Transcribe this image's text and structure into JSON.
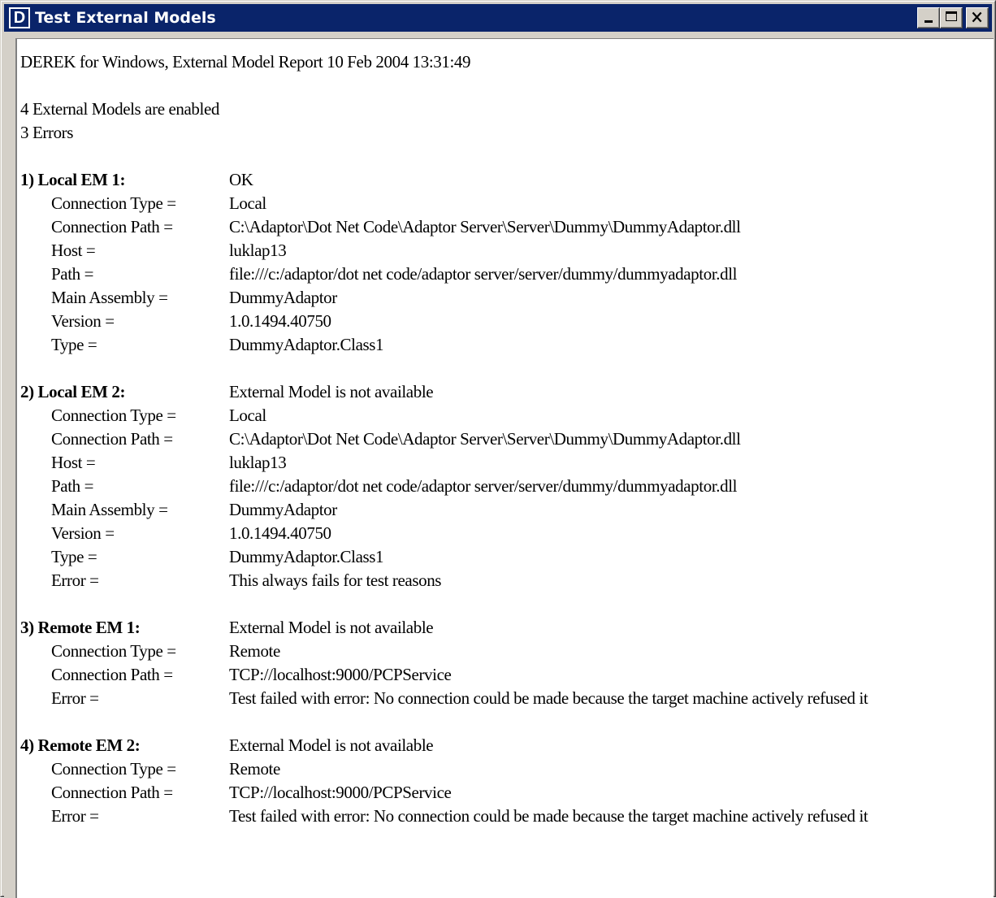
{
  "window": {
    "title": "Test External Models",
    "app_icon_letter": "D",
    "buttons": {
      "minimize": "minimize-button",
      "maximize": "maximize-button",
      "close": "close-button"
    }
  },
  "report": {
    "heading": "DEREK for Windows, External Model Report  10 Feb 2004  13:31:49",
    "enabled_line": "4 External Models are enabled",
    "errors_line": "3 Errors",
    "sections": [
      {
        "label": "1) Local EM 1:",
        "status": "OK",
        "rows": [
          {
            "key": "Connection Type =",
            "value": "Local"
          },
          {
            "key": "Connection Path =",
            "value": "C:\\Adaptor\\Dot Net Code\\Adaptor Server\\Server\\Dummy\\DummyAdaptor.dll"
          },
          {
            "key": "Host =",
            "value": "luklap13"
          },
          {
            "key": "Path =",
            "value": "file:///c:/adaptor/dot net code/adaptor server/server/dummy/dummyadaptor.dll"
          },
          {
            "key": "Main Assembly =",
            "value": "DummyAdaptor"
          },
          {
            "key": "Version =",
            "value": "1.0.1494.40750"
          },
          {
            "key": "Type =",
            "value": "DummyAdaptor.Class1"
          }
        ]
      },
      {
        "label": "2) Local EM 2:",
        "status": "External Model is not available",
        "rows": [
          {
            "key": "Connection Type =",
            "value": "Local"
          },
          {
            "key": "Connection Path =",
            "value": "C:\\Adaptor\\Dot Net Code\\Adaptor Server\\Server\\Dummy\\DummyAdaptor.dll"
          },
          {
            "key": "Host =",
            "value": "luklap13"
          },
          {
            "key": "Path =",
            "value": "file:///c:/adaptor/dot net code/adaptor server/server/dummy/dummyadaptor.dll"
          },
          {
            "key": "Main Assembly =",
            "value": "DummyAdaptor"
          },
          {
            "key": "Version =",
            "value": "1.0.1494.40750"
          },
          {
            "key": "Type =",
            "value": "DummyAdaptor.Class1"
          },
          {
            "key": "Error =",
            "value": "This always fails for test reasons"
          }
        ]
      },
      {
        "label": "3) Remote EM 1:",
        "status": "External Model is not available",
        "rows": [
          {
            "key": "Connection Type =",
            "value": "Remote"
          },
          {
            "key": "Connection Path =",
            "value": "TCP://localhost:9000/PCPService"
          },
          {
            "key": "Error =",
            "value": "Test failed with error: No connection could be made because the target machine actively refused it"
          }
        ]
      },
      {
        "label": "4) Remote EM 2:",
        "status": "External Model is not available",
        "rows": [
          {
            "key": "Connection Type =",
            "value": "Remote"
          },
          {
            "key": "Connection Path =",
            "value": "TCP://localhost:9000/PCPService"
          },
          {
            "key": "Error =",
            "value": "Test failed with error: No connection could be made because the target machine actively refused it"
          }
        ]
      }
    ]
  },
  "colors": {
    "titlebar": "#0a246a",
    "chrome": "#d4d0c8",
    "client_bg": "#ffffff",
    "text": "#000000"
  }
}
